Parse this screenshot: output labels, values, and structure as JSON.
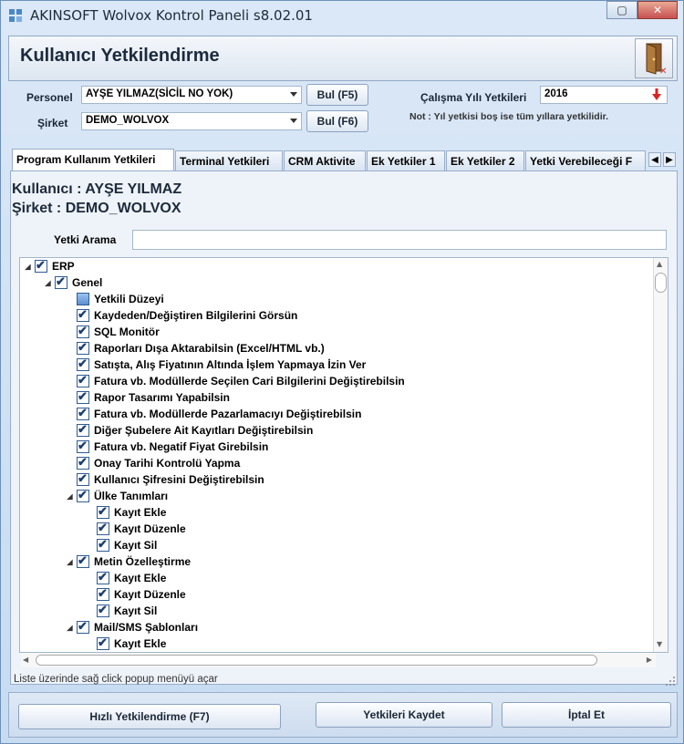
{
  "window": {
    "title": "AKINSOFT Wolvox Kontrol Paneli s8.02.01"
  },
  "header": {
    "title": "Kullanıcı Yetkilendirme"
  },
  "form": {
    "personel_label": "Personel",
    "personel_value": "AYŞE YILMAZ(SİCİL NO YOK)",
    "personel_btn": "Bul (F5)",
    "sirket_label": "Şirket",
    "sirket_value": "DEMO_WOLVOX",
    "sirket_btn": "Bul (F6)",
    "calisma_label": "Çalışma Yılı Yetkileri",
    "calisma_value": "2016",
    "note": "Not : Yıl yetkisi boş ise tüm yıllara yetkilidir."
  },
  "tabs": [
    "Program Kullanım Yetkileri",
    "Terminal Yetkileri",
    "CRM Aktivite",
    "Ek Yetkiler 1",
    "Ek Yetkiler 2",
    "Yetki Verebileceği F"
  ],
  "info": {
    "user_line": "Kullanıcı : AYŞE YILMAZ",
    "company_line": "Şirket : DEMO_WOLVOX"
  },
  "search": {
    "label": "Yetki Arama",
    "placeholder": ""
  },
  "tree": [
    {
      "label": "ERP",
      "level": 0,
      "state": "checked",
      "expander": "expanded"
    },
    {
      "label": "Genel",
      "level": 1,
      "state": "checked",
      "expander": "expanded"
    },
    {
      "label": "Yetkili Düzeyi",
      "level": 2,
      "state": "partial",
      "expander": "none"
    },
    {
      "label": "Kaydeden/Değiştiren Bilgilerini Görsün",
      "level": 2,
      "state": "checked",
      "expander": "none"
    },
    {
      "label": "SQL Monitör",
      "level": 2,
      "state": "checked",
      "expander": "none"
    },
    {
      "label": "Raporları Dışa Aktarabilsin (Excel/HTML vb.)",
      "level": 2,
      "state": "checked",
      "expander": "none"
    },
    {
      "label": "Satışta, Alış Fiyatının Altında İşlem Yapmaya İzin Ver",
      "level": 2,
      "state": "checked",
      "expander": "none"
    },
    {
      "label": "Fatura vb. Modüllerde Seçilen Cari Bilgilerini Değiştirebilsin",
      "level": 2,
      "state": "checked",
      "expander": "none"
    },
    {
      "label": "Rapor Tasarımı Yapabilsin",
      "level": 2,
      "state": "checked",
      "expander": "none"
    },
    {
      "label": "Fatura vb. Modüllerde Pazarlamacıyı Değiştirebilsin",
      "level": 2,
      "state": "checked",
      "expander": "none"
    },
    {
      "label": "Diğer Şubelere Ait Kayıtları Değiştirebilsin",
      "level": 2,
      "state": "checked",
      "expander": "none"
    },
    {
      "label": "Fatura vb. Negatif Fiyat Girebilsin",
      "level": 2,
      "state": "checked",
      "expander": "none"
    },
    {
      "label": "Onay Tarihi Kontrolü Yapma",
      "level": 2,
      "state": "checked",
      "expander": "none"
    },
    {
      "label": "Kullanıcı Şifresini Değiştirebilsin",
      "level": 2,
      "state": "checked",
      "expander": "none"
    },
    {
      "label": "Ülke Tanımları",
      "level": 2,
      "state": "checked",
      "expander": "expanded"
    },
    {
      "label": "Kayıt Ekle",
      "level": 3,
      "state": "checked",
      "expander": "none"
    },
    {
      "label": "Kayıt Düzenle",
      "level": 3,
      "state": "checked",
      "expander": "none"
    },
    {
      "label": "Kayıt Sil",
      "level": 3,
      "state": "checked",
      "expander": "none"
    },
    {
      "label": "Metin Özelleştirme",
      "level": 2,
      "state": "checked",
      "expander": "expanded"
    },
    {
      "label": "Kayıt Ekle",
      "level": 3,
      "state": "checked",
      "expander": "none"
    },
    {
      "label": "Kayıt Düzenle",
      "level": 3,
      "state": "checked",
      "expander": "none"
    },
    {
      "label": "Kayıt Sil",
      "level": 3,
      "state": "checked",
      "expander": "none"
    },
    {
      "label": "Mail/SMS Şablonları",
      "level": 2,
      "state": "checked",
      "expander": "expanded"
    },
    {
      "label": "Kayıt Ekle",
      "level": 3,
      "state": "checked",
      "expander": "none"
    }
  ],
  "status": "Liste üzerinde sağ click popup menüyü açar",
  "footer": {
    "quick_auth": "Hızlı Yetkilendirme (F7)",
    "save": "Yetkileri Kaydet",
    "cancel": "İptal Et"
  }
}
